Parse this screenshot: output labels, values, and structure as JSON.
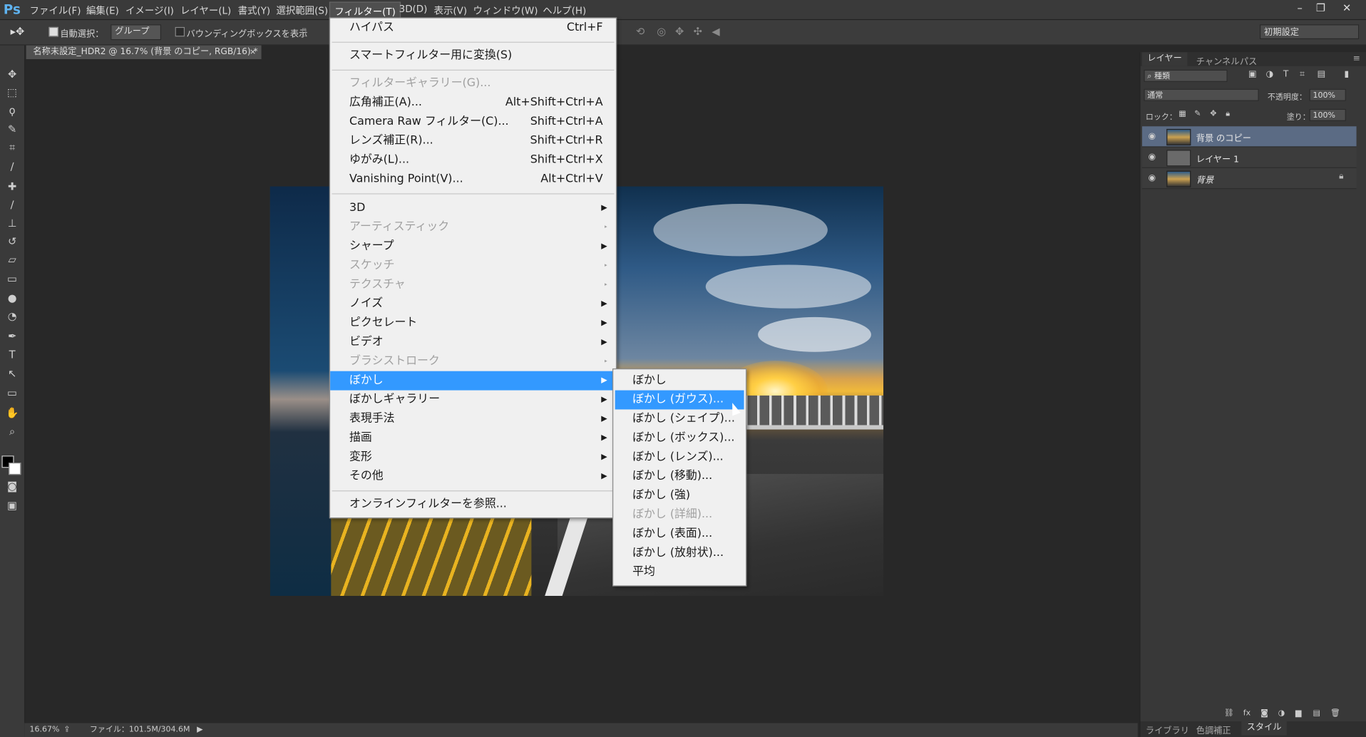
{
  "menubar": {
    "logo": "Ps",
    "items": [
      "ファイル(F)",
      "編集(E)",
      "イメージ(I)",
      "レイヤー(L)",
      "書式(Y)",
      "選択範囲(S)",
      "フィルター(T)",
      "3D(D)",
      "表示(V)",
      "ウィンドウ(W)",
      "ヘルプ(H)"
    ],
    "active_index": 6
  },
  "options": {
    "auto_select": "自動選択：",
    "group": "グループ",
    "bounding_box": "バウンディングボックスを表示",
    "workspace": "初期設定"
  },
  "document": {
    "tab_title": "名称未設定_HDR2 @ 16.7% (背景 のコピー, RGB/16) *",
    "zoom": "16.67%",
    "file_info": "ファイル：101.5M/304.6M"
  },
  "filter_menu": {
    "items": [
      {
        "label": "ハイパス",
        "shortcut": "Ctrl+F"
      },
      {
        "label": "スマートフィルター用に変換(S)",
        "shortcut": ""
      },
      {
        "label": "フィルターギャラリー(G)...",
        "shortcut": "",
        "disabled": true
      },
      {
        "label": "広角補正(A)...",
        "shortcut": "Alt+Shift+Ctrl+A"
      },
      {
        "label": "Camera Raw フィルター(C)...",
        "shortcut": "Shift+Ctrl+A"
      },
      {
        "label": "レンズ補正(R)...",
        "shortcut": "Shift+Ctrl+R"
      },
      {
        "label": "ゆがみ(L)...",
        "shortcut": "Shift+Ctrl+X"
      },
      {
        "label": "Vanishing Point(V)...",
        "shortcut": "Alt+Ctrl+V"
      },
      {
        "label": "3D"
      },
      {
        "label": "アーティスティック",
        "disabled": true
      },
      {
        "label": "シャープ"
      },
      {
        "label": "スケッチ",
        "disabled": true
      },
      {
        "label": "テクスチャ",
        "disabled": true
      },
      {
        "label": "ノイズ"
      },
      {
        "label": "ピクセレート"
      },
      {
        "label": "ビデオ"
      },
      {
        "label": "ブラシストローク",
        "disabled": true
      },
      {
        "label": "ぼかし",
        "highlight": true
      },
      {
        "label": "ぼかしギャラリー"
      },
      {
        "label": "表現手法"
      },
      {
        "label": "描画"
      },
      {
        "label": "変形"
      },
      {
        "label": "その他"
      },
      {
        "label": "オンラインフィルターを参照..."
      }
    ]
  },
  "blur_submenu": {
    "items": [
      {
        "label": "ぼかし"
      },
      {
        "label": "ぼかし (ガウス)...",
        "highlight": true
      },
      {
        "label": "ぼかし (シェイプ)..."
      },
      {
        "label": "ぼかし (ボックス)..."
      },
      {
        "label": "ぼかし (レンズ)..."
      },
      {
        "label": "ぼかし (移動)..."
      },
      {
        "label": "ぼかし (強)"
      },
      {
        "label": "ぼかし (詳細)...",
        "disabled": true
      },
      {
        "label": "ぼかし (表面)..."
      },
      {
        "label": "ぼかし (放射状)..."
      },
      {
        "label": "平均"
      }
    ]
  },
  "layers_panel": {
    "tabs": [
      "レイヤー",
      "チャンネル",
      "パス"
    ],
    "filter_kind": "種類",
    "blend_mode": "通常",
    "opacity_label": "不透明度：",
    "opacity": "100%",
    "lock_label": "ロック：",
    "fill_label": "塗り：",
    "fill": "100%",
    "layers": [
      {
        "name": "背景 のコピー",
        "selected": true
      },
      {
        "name": "レイヤー 1"
      },
      {
        "name": "背景",
        "locked": true
      }
    ],
    "bottom_tabs": [
      "ライブラリ",
      "色調補正",
      "スタイル"
    ]
  },
  "colors": {
    "highlight": "#3399ff",
    "layer_selected": "#5b6b84",
    "logo": "#5fb3f0"
  }
}
